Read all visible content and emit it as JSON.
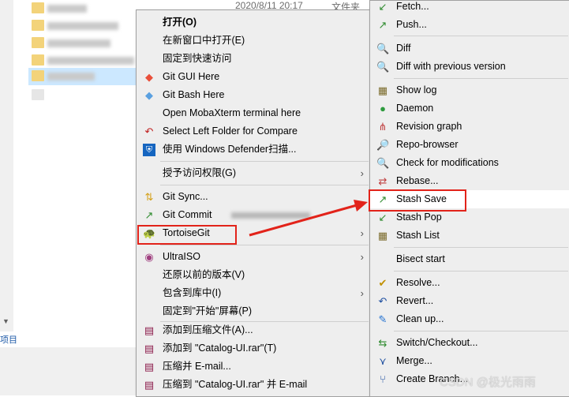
{
  "explorer": {
    "date_col": "2020/8/11 20:17",
    "type_col": "文件夹",
    "status_text": "项目"
  },
  "menu_main": {
    "items": [
      {
        "label": "打开(O)",
        "icon": "",
        "bold": true
      },
      {
        "label": "在新窗口中打开(E)",
        "icon": ""
      },
      {
        "label": "固定到快速访问",
        "icon": ""
      },
      {
        "label": "Git GUI Here",
        "icon": "git-diamond-icon"
      },
      {
        "label": "Git Bash Here",
        "icon": "git-diamond-icon"
      },
      {
        "label": "Open MobaXterm terminal here",
        "icon": ""
      },
      {
        "label": "Select Left Folder for Compare",
        "icon": "compare-icon"
      },
      {
        "label": "使用 Windows Defender扫描...",
        "icon": "defender-shield-icon"
      },
      {
        "label": "授予访问权限(G)",
        "icon": "",
        "submenu": true
      },
      {
        "label": "Git Sync...",
        "icon": "git-sync-icon"
      },
      {
        "label": "Git Commit",
        "icon": "git-commit-icon"
      },
      {
        "label": "TortoiseGit",
        "icon": "tortoisegit-icon",
        "submenu": true
      },
      {
        "label": "UltraISO",
        "icon": "ultraiso-disc-icon",
        "submenu": true
      },
      {
        "label": "还原以前的版本(V)",
        "icon": ""
      },
      {
        "label": "包含到库中(I)",
        "icon": "",
        "submenu": true
      },
      {
        "label": "固定到\"开始\"屏幕(P)",
        "icon": ""
      },
      {
        "label": "添加到压缩文件(A)...",
        "icon": "winrar-icon"
      },
      {
        "label": "添加到 \"Catalog-UI.rar\"(T)",
        "icon": "winrar-icon"
      },
      {
        "label": "压缩并 E-mail...",
        "icon": "winrar-icon"
      },
      {
        "label": "压缩到 \"Catalog-UI.rar\" 并 E-mail",
        "icon": "winrar-icon"
      }
    ]
  },
  "menu_tortoise": {
    "items": [
      {
        "label": "Fetch...",
        "icon": "fetch-icon"
      },
      {
        "label": "Push...",
        "icon": "push-icon"
      },
      {
        "label": "Diff",
        "icon": "diff-icon"
      },
      {
        "label": "Diff with previous version",
        "icon": "diff-icon"
      },
      {
        "label": "Show log",
        "icon": "log-icon"
      },
      {
        "label": "Daemon",
        "icon": "daemon-icon"
      },
      {
        "label": "Revision graph",
        "icon": "revision-graph-icon"
      },
      {
        "label": "Repo-browser",
        "icon": "repo-browser-icon"
      },
      {
        "label": "Check for modifications",
        "icon": "check-modifications-icon"
      },
      {
        "label": "Rebase...",
        "icon": "rebase-icon"
      },
      {
        "label": "Stash Save",
        "icon": "stash-save-icon"
      },
      {
        "label": "Stash Pop",
        "icon": "stash-pop-icon"
      },
      {
        "label": "Stash List",
        "icon": "stash-list-icon"
      },
      {
        "label": "Bisect start",
        "icon": ""
      },
      {
        "label": "Resolve...",
        "icon": "resolve-icon"
      },
      {
        "label": "Revert...",
        "icon": "revert-icon"
      },
      {
        "label": "Clean up...",
        "icon": "cleanup-icon"
      },
      {
        "label": "Switch/Checkout...",
        "icon": "switch-icon"
      },
      {
        "label": "Merge...",
        "icon": "merge-icon"
      },
      {
        "label": "Create Branch...",
        "icon": "branch-icon"
      }
    ]
  },
  "watermark": "CSDN @极光雨雨",
  "colors": {
    "highlight_box": "#e2231a",
    "menu_bg": "#eeeeee",
    "selection": "#cce8ff"
  }
}
